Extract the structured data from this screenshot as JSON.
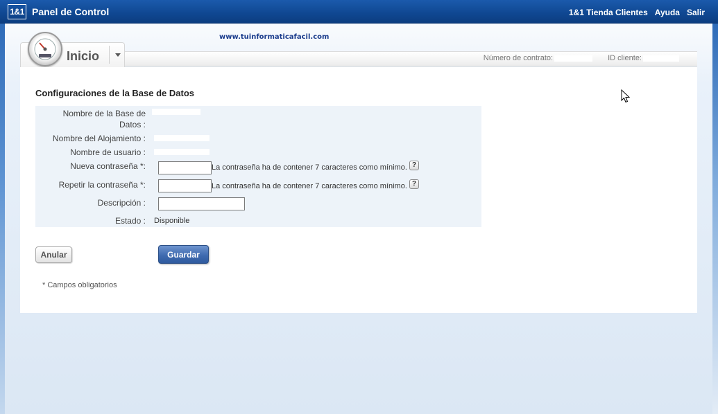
{
  "header": {
    "logo_text": "1&1",
    "title": "Panel de Control",
    "links": [
      "1&1 Tienda Clientes",
      "Ayuda",
      "Salir"
    ]
  },
  "watermark": "www.tuinformaticafacil.com",
  "nav": {
    "home_label": "Inicio",
    "contract_label": "Número de contrato:",
    "client_id_label": "ID cliente:"
  },
  "form": {
    "title": "Configuraciones de la Base de Datos",
    "db_name_label_line1": "Nombre de la Base de",
    "db_name_label_line2": "Datos :",
    "host_name_label": "Nombre del Alojamiento :",
    "username_label": "Nombre de usuario :",
    "new_password_label": "Nueva contraseña *:",
    "repeat_password_label": "Repetir la contraseña *:",
    "description_label": "Descripción :",
    "status_label": "Estado :",
    "status_value": "Disponible",
    "password_hint": "La contraseña ha de contener 7 caracteres como mínimo.",
    "help_glyph": "?",
    "new_password_value": "",
    "repeat_password_value": "",
    "description_value": ""
  },
  "buttons": {
    "cancel": "Anular",
    "save": "Guardar"
  },
  "footnote": "* Campos obligatorios",
  "icons": {
    "gauge": "speedometer-icon",
    "dropdown": "caret-down-icon",
    "help": "question-mark-icon",
    "cursor": "mouse-pointer-icon"
  },
  "colors": {
    "header_bg": "#0f4791",
    "form_panel_bg": "#edf3f9",
    "save_button": "#3f6bb0",
    "watermark": "#1a3c8c"
  }
}
